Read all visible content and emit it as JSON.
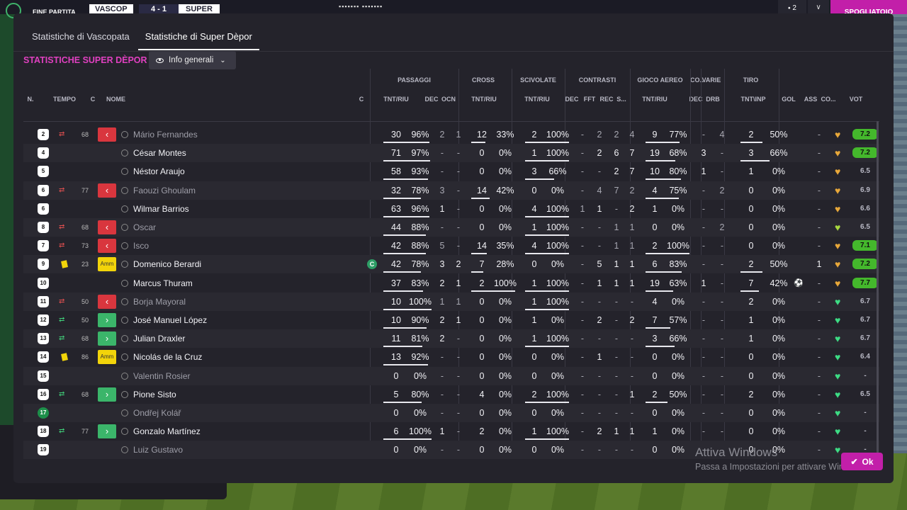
{
  "topbar": {
    "label": "FINE PARTITA",
    "team_home": "VASCOP",
    "score": "4 - 1",
    "team_away": "SUPER",
    "dots": "▪▪▪▪▪▪▪ ▪▪▪▪▪▪▪",
    "icon_btn": "⬩ 2",
    "cta": "SPOGLIATOIO"
  },
  "tabs": [
    "Statistiche di Vascopata",
    "Statistiche di Super Dèpor"
  ],
  "section_title": "STATISTICHE SUPER DÈPOR",
  "dropdown": {
    "label": "Info generali"
  },
  "groups": [
    "PASSAGGI",
    "CROSS",
    "SCIVOLATE",
    "CONTRASTI",
    "GIOCO AEREO",
    "CO...",
    "VARIE",
    "TIRO"
  ],
  "headers": {
    "n": "N.",
    "tempo": "TEMPO",
    "c": "C",
    "nome": "NOME",
    "c2": "C",
    "pass_tnt": "TNT/RIU",
    "pass_dec": "DEC",
    "pass_ocn": "OCN",
    "cross_tnt": "TNT/RIU",
    "sciv_tnt": "TNT/RIU",
    "con_dec": "DEC",
    "con_fft": "FFT",
    "con_rec": "REC",
    "con_s": "S...",
    "aereo_tnt": "TNT/RIU",
    "co_dec": "DEC",
    "varie_drb": "DRB",
    "tiro_tnt": "TNT\\INP",
    "gol": "GOL",
    "ass": "ASS",
    "co": "CO...",
    "vot": "VOT"
  },
  "players": [
    {
      "num": "2",
      "sub": "out",
      "min": "68",
      "action": "out",
      "name": "Mário Fernandes",
      "dim": true,
      "pass_t": "30",
      "pass_p": "96%",
      "pass_pct": 0.96,
      "pass_dec": "2",
      "pass_ocn": "1",
      "cross_t": "12",
      "cross_p": "33%",
      "cross_pct": 0.33,
      "sciv_t": "2",
      "sciv_p": "100%",
      "sciv_pct": 1.0,
      "con_dec": "-",
      "con_fft": "2",
      "con_rec": "2",
      "con_s": "4",
      "aer_t": "9",
      "aer_p": "77%",
      "aer_pct": 0.77,
      "co_dec": "-",
      "drb": "4",
      "tiro_t": "2",
      "tiro_p": "50%",
      "tiro_pct": 0.5,
      "gol": "",
      "ass": "-",
      "heart": "#e8a83a",
      "vot": "7.2",
      "vot_green": true,
      "captain": false,
      "ball": false
    },
    {
      "num": "4",
      "sub": "",
      "min": "",
      "action": "",
      "name": "César Montes",
      "dim": false,
      "pass_t": "71",
      "pass_p": "97%",
      "pass_pct": 0.97,
      "pass_dec": "-",
      "pass_ocn": "-",
      "cross_t": "0",
      "cross_p": "0%",
      "cross_pct": 0,
      "sciv_t": "1",
      "sciv_p": "100%",
      "sciv_pct": 1.0,
      "con_dec": "-",
      "con_fft": "2",
      "con_rec": "6",
      "con_s": "7",
      "aer_t": "19",
      "aer_p": "68%",
      "aer_pct": 0.68,
      "co_dec": "3",
      "drb": "-",
      "tiro_t": "3",
      "tiro_p": "66%",
      "tiro_pct": 0.66,
      "gol": "",
      "ass": "-",
      "heart": "#e8a83a",
      "vot": "7.2",
      "vot_green": true,
      "captain": false,
      "ball": false
    },
    {
      "num": "5",
      "sub": "",
      "min": "",
      "action": "",
      "name": "Néstor Araujo",
      "dim": false,
      "pass_t": "58",
      "pass_p": "93%",
      "pass_pct": 0.93,
      "pass_dec": "-",
      "pass_ocn": "-",
      "cross_t": "0",
      "cross_p": "0%",
      "cross_pct": 0,
      "sciv_t": "3",
      "sciv_p": "66%",
      "sciv_pct": 0.66,
      "con_dec": "-",
      "con_fft": "-",
      "con_rec": "2",
      "con_s": "7",
      "aer_t": "10",
      "aer_p": "80%",
      "aer_pct": 0.8,
      "co_dec": "1",
      "drb": "-",
      "tiro_t": "1",
      "tiro_p": "0%",
      "tiro_pct": 0,
      "gol": "",
      "ass": "-",
      "heart": "#e8a83a",
      "vot": "6.5",
      "vot_green": false,
      "captain": false,
      "ball": false
    },
    {
      "num": "6",
      "sub": "out",
      "min": "77",
      "action": "out",
      "name": "Faouzi Ghoulam",
      "dim": true,
      "pass_t": "32",
      "pass_p": "78%",
      "pass_pct": 0.78,
      "pass_dec": "3",
      "pass_ocn": "-",
      "cross_t": "14",
      "cross_p": "42%",
      "cross_pct": 0.42,
      "sciv_t": "0",
      "sciv_p": "0%",
      "sciv_pct": 0,
      "con_dec": "-",
      "con_fft": "4",
      "con_rec": "7",
      "con_s": "2",
      "aer_t": "4",
      "aer_p": "75%",
      "aer_pct": 0.75,
      "co_dec": "-",
      "drb": "2",
      "tiro_t": "0",
      "tiro_p": "0%",
      "tiro_pct": 0,
      "gol": "",
      "ass": "-",
      "heart": "#e8a83a",
      "vot": "6.9",
      "vot_green": false,
      "captain": false,
      "ball": false
    },
    {
      "num": "6",
      "sub": "",
      "min": "",
      "action": "",
      "name": "Wilmar Barrios",
      "dim": false,
      "pass_t": "63",
      "pass_p": "96%",
      "pass_pct": 0.96,
      "pass_dec": "1",
      "pass_ocn": "-",
      "cross_t": "0",
      "cross_p": "0%",
      "cross_pct": 0,
      "sciv_t": "4",
      "sciv_p": "100%",
      "sciv_pct": 1.0,
      "con_dec": "1",
      "con_fft": "1",
      "con_rec": "-",
      "con_s": "2",
      "aer_t": "1",
      "aer_p": "0%",
      "aer_pct": 0,
      "co_dec": "-",
      "drb": "-",
      "tiro_t": "0",
      "tiro_p": "0%",
      "tiro_pct": 0,
      "gol": "",
      "ass": "-",
      "heart": "#e8a83a",
      "vot": "6.6",
      "vot_green": false,
      "captain": false,
      "ball": false
    },
    {
      "num": "8",
      "sub": "out",
      "min": "68",
      "action": "out",
      "name": "Oscar",
      "dim": true,
      "pass_t": "44",
      "pass_p": "88%",
      "pass_pct": 0.88,
      "pass_dec": "-",
      "pass_ocn": "-",
      "cross_t": "0",
      "cross_p": "0%",
      "cross_pct": 0,
      "sciv_t": "1",
      "sciv_p": "100%",
      "sciv_pct": 1.0,
      "con_dec": "-",
      "con_fft": "-",
      "con_rec": "1",
      "con_s": "1",
      "aer_t": "0",
      "aer_p": "0%",
      "aer_pct": 0,
      "co_dec": "-",
      "drb": "2",
      "tiro_t": "0",
      "tiro_p": "0%",
      "tiro_pct": 0,
      "gol": "",
      "ass": "-",
      "heart": "#a8d840",
      "vot": "6.5",
      "vot_green": false,
      "captain": false,
      "ball": false
    },
    {
      "num": "7",
      "sub": "out",
      "min": "73",
      "action": "out",
      "name": "Isco",
      "dim": true,
      "pass_t": "42",
      "pass_p": "88%",
      "pass_pct": 0.88,
      "pass_dec": "5",
      "pass_ocn": "-",
      "cross_t": "14",
      "cross_p": "35%",
      "cross_pct": 0.35,
      "sciv_t": "4",
      "sciv_p": "100%",
      "sciv_pct": 1.0,
      "con_dec": "-",
      "con_fft": "-",
      "con_rec": "1",
      "con_s": "1",
      "aer_t": "2",
      "aer_p": "100%",
      "aer_pct": 1.0,
      "co_dec": "-",
      "drb": "-",
      "tiro_t": "0",
      "tiro_p": "0%",
      "tiro_pct": 0,
      "gol": "",
      "ass": "-",
      "heart": "#e8a83a",
      "vot": "7.1",
      "vot_green": true,
      "captain": false,
      "ball": false
    },
    {
      "num": "9",
      "sub": "yellow",
      "min": "23",
      "action": "amm",
      "name": "Domenico Berardi",
      "dim": false,
      "pass_t": "42",
      "pass_p": "78%",
      "pass_pct": 0.78,
      "pass_dec": "3",
      "pass_ocn": "2",
      "cross_t": "7",
      "cross_p": "28%",
      "cross_pct": 0.28,
      "sciv_t": "0",
      "sciv_p": "0%",
      "sciv_pct": 0,
      "con_dec": "-",
      "con_fft": "5",
      "con_rec": "1",
      "con_s": "1",
      "aer_t": "6",
      "aer_p": "83%",
      "aer_pct": 0.83,
      "co_dec": "-",
      "drb": "-",
      "tiro_t": "2",
      "tiro_p": "50%",
      "tiro_pct": 0.5,
      "gol": "",
      "ass": "1",
      "heart": "#e8a83a",
      "vot": "7.2",
      "vot_green": true,
      "captain": true,
      "ball": false
    },
    {
      "num": "10",
      "sub": "",
      "min": "",
      "action": "",
      "name": "Marcus Thuram",
      "dim": false,
      "pass_t": "37",
      "pass_p": "83%",
      "pass_pct": 0.83,
      "pass_dec": "2",
      "pass_ocn": "1",
      "cross_t": "2",
      "cross_p": "100%",
      "cross_pct": 1.0,
      "sciv_t": "1",
      "sciv_p": "100%",
      "sciv_pct": 1.0,
      "con_dec": "-",
      "con_fft": "1",
      "con_rec": "1",
      "con_s": "1",
      "aer_t": "19",
      "aer_p": "63%",
      "aer_pct": 0.63,
      "co_dec": "1",
      "drb": "-",
      "tiro_t": "7",
      "tiro_p": "42%",
      "tiro_pct": 0.42,
      "gol": "⚽",
      "ass": "-",
      "heart": "#e8a83a",
      "vot": "7.7",
      "vot_green": true,
      "captain": false,
      "ball": true
    },
    {
      "num": "11",
      "sub": "out",
      "min": "50",
      "action": "out",
      "name": "Borja Mayoral",
      "dim": true,
      "pass_t": "10",
      "pass_p": "100%",
      "pass_pct": 1.0,
      "pass_dec": "1",
      "pass_ocn": "1",
      "cross_t": "0",
      "cross_p": "0%",
      "cross_pct": 0,
      "sciv_t": "1",
      "sciv_p": "100%",
      "sciv_pct": 1.0,
      "con_dec": "-",
      "con_fft": "-",
      "con_rec": "-",
      "con_s": "-",
      "aer_t": "4",
      "aer_p": "0%",
      "aer_pct": 0,
      "co_dec": "-",
      "drb": "-",
      "tiro_t": "2",
      "tiro_p": "0%",
      "tiro_pct": 0,
      "gol": "",
      "ass": "-",
      "heart": "#3ddc84",
      "vot": "6.7",
      "vot_green": false,
      "captain": false,
      "ball": false
    },
    {
      "num": "12",
      "sub": "in",
      "min": "50",
      "action": "in",
      "name": "José Manuel López",
      "dim": false,
      "pass_t": "10",
      "pass_p": "90%",
      "pass_pct": 0.9,
      "pass_dec": "2",
      "pass_ocn": "1",
      "cross_t": "0",
      "cross_p": "0%",
      "cross_pct": 0,
      "sciv_t": "1",
      "sciv_p": "0%",
      "sciv_pct": 0,
      "con_dec": "-",
      "con_fft": "2",
      "con_rec": "-",
      "con_s": "2",
      "aer_t": "7",
      "aer_p": "57%",
      "aer_pct": 0.57,
      "co_dec": "-",
      "drb": "-",
      "tiro_t": "1",
      "tiro_p": "0%",
      "tiro_pct": 0,
      "gol": "",
      "ass": "-",
      "heart": "#3ddc84",
      "vot": "6.7",
      "vot_green": false,
      "captain": false,
      "ball": false
    },
    {
      "num": "13",
      "sub": "in",
      "min": "68",
      "action": "in",
      "name": "Julian Draxler",
      "dim": false,
      "pass_t": "11",
      "pass_p": "81%",
      "pass_pct": 0.81,
      "pass_dec": "2",
      "pass_ocn": "-",
      "cross_t": "0",
      "cross_p": "0%",
      "cross_pct": 0,
      "sciv_t": "1",
      "sciv_p": "100%",
      "sciv_pct": 1.0,
      "con_dec": "-",
      "con_fft": "-",
      "con_rec": "-",
      "con_s": "-",
      "aer_t": "3",
      "aer_p": "66%",
      "aer_pct": 0.66,
      "co_dec": "-",
      "drb": "-",
      "tiro_t": "1",
      "tiro_p": "0%",
      "tiro_pct": 0,
      "gol": "",
      "ass": "-",
      "heart": "#3ddc84",
      "vot": "6.7",
      "vot_green": false,
      "captain": false,
      "ball": false
    },
    {
      "num": "14",
      "sub": "yellow",
      "min": "86",
      "action": "amm",
      "name": "Nicolás de la Cruz",
      "dim": false,
      "pass_t": "13",
      "pass_p": "92%",
      "pass_pct": 0.92,
      "pass_dec": "-",
      "pass_ocn": "-",
      "cross_t": "0",
      "cross_p": "0%",
      "cross_pct": 0,
      "sciv_t": "0",
      "sciv_p": "0%",
      "sciv_pct": 0,
      "con_dec": "-",
      "con_fft": "1",
      "con_rec": "-",
      "con_s": "-",
      "aer_t": "0",
      "aer_p": "0%",
      "aer_pct": 0,
      "co_dec": "-",
      "drb": "-",
      "tiro_t": "0",
      "tiro_p": "0%",
      "tiro_pct": 0,
      "gol": "",
      "ass": "-",
      "heart": "#3ddc84",
      "vot": "6.4",
      "vot_green": false,
      "captain": false,
      "ball": false
    },
    {
      "num": "15",
      "sub": "",
      "min": "",
      "action": "",
      "name": "Valentin Rosier",
      "dim": true,
      "pass_t": "0",
      "pass_p": "0%",
      "pass_pct": 0,
      "pass_dec": "-",
      "pass_ocn": "-",
      "cross_t": "0",
      "cross_p": "0%",
      "cross_pct": 0,
      "sciv_t": "0",
      "sciv_p": "0%",
      "sciv_pct": 0,
      "con_dec": "-",
      "con_fft": "-",
      "con_rec": "-",
      "con_s": "-",
      "aer_t": "0",
      "aer_p": "0%",
      "aer_pct": 0,
      "co_dec": "-",
      "drb": "-",
      "tiro_t": "0",
      "tiro_p": "0%",
      "tiro_pct": 0,
      "gol": "",
      "ass": "-",
      "heart": "#3ddc84",
      "vot": "-",
      "vot_green": false,
      "captain": false,
      "ball": false
    },
    {
      "num": "16",
      "sub": "in",
      "min": "68",
      "action": "in",
      "name": "Pione Sisto",
      "dim": false,
      "pass_t": "5",
      "pass_p": "80%",
      "pass_pct": 0.8,
      "pass_dec": "-",
      "pass_ocn": "-",
      "cross_t": "4",
      "cross_p": "0%",
      "cross_pct": 0,
      "sciv_t": "2",
      "sciv_p": "100%",
      "sciv_pct": 1.0,
      "con_dec": "-",
      "con_fft": "-",
      "con_rec": "-",
      "con_s": "1",
      "aer_t": "2",
      "aer_p": "50%",
      "aer_pct": 0.5,
      "co_dec": "-",
      "drb": "-",
      "tiro_t": "2",
      "tiro_p": "0%",
      "tiro_pct": 0,
      "gol": "",
      "ass": "-",
      "heart": "#3ddc84",
      "vot": "6.5",
      "vot_green": false,
      "captain": false,
      "ball": false
    },
    {
      "num": "17",
      "sub": "",
      "min": "",
      "action": "",
      "name": "Ondřej Kolář",
      "dim": true,
      "gk": true,
      "pass_t": "0",
      "pass_p": "0%",
      "pass_pct": 0,
      "pass_dec": "-",
      "pass_ocn": "-",
      "cross_t": "0",
      "cross_p": "0%",
      "cross_pct": 0,
      "sciv_t": "0",
      "sciv_p": "0%",
      "sciv_pct": 0,
      "con_dec": "-",
      "con_fft": "-",
      "con_rec": "-",
      "con_s": "-",
      "aer_t": "0",
      "aer_p": "0%",
      "aer_pct": 0,
      "co_dec": "-",
      "drb": "-",
      "tiro_t": "0",
      "tiro_p": "0%",
      "tiro_pct": 0,
      "gol": "",
      "ass": "-",
      "heart": "#3ddc84",
      "vot": "-",
      "vot_green": false,
      "captain": false,
      "ball": false
    },
    {
      "num": "18",
      "sub": "in",
      "min": "77",
      "action": "in",
      "name": "Gonzalo Martínez",
      "dim": false,
      "pass_t": "6",
      "pass_p": "100%",
      "pass_pct": 1.0,
      "pass_dec": "1",
      "pass_ocn": "-",
      "cross_t": "2",
      "cross_p": "0%",
      "cross_pct": 0,
      "sciv_t": "1",
      "sciv_p": "100%",
      "sciv_pct": 1.0,
      "con_dec": "-",
      "con_fft": "2",
      "con_rec": "1",
      "con_s": "1",
      "aer_t": "1",
      "aer_p": "0%",
      "aer_pct": 0,
      "co_dec": "-",
      "drb": "-",
      "tiro_t": "0",
      "tiro_p": "0%",
      "tiro_pct": 0,
      "gol": "",
      "ass": "-",
      "heart": "#3ddc84",
      "vot": "-",
      "vot_green": false,
      "captain": false,
      "ball": false
    },
    {
      "num": "19",
      "sub": "",
      "min": "",
      "action": "",
      "name": "Luiz Gustavo",
      "dim": true,
      "pass_t": "0",
      "pass_p": "0%",
      "pass_pct": 0,
      "pass_dec": "-",
      "pass_ocn": "-",
      "cross_t": "0",
      "cross_p": "0%",
      "cross_pct": 0,
      "sciv_t": "0",
      "sciv_p": "0%",
      "sciv_pct": 0,
      "con_dec": "-",
      "con_fft": "-",
      "con_rec": "-",
      "con_s": "-",
      "aer_t": "0",
      "aer_p": "0%",
      "aer_pct": 0,
      "co_dec": "-",
      "drb": "-",
      "tiro_t": "0",
      "tiro_p": "0%",
      "tiro_pct": 0,
      "gol": "",
      "ass": "-",
      "heart": "#3ddc84",
      "vot": "-",
      "vot_green": false,
      "captain": false,
      "ball": false
    }
  ],
  "ok_label": "Ok",
  "watermark": {
    "title": "Attiva Windows",
    "subtitle": "Passa a Impostazioni per attivare Windows."
  }
}
